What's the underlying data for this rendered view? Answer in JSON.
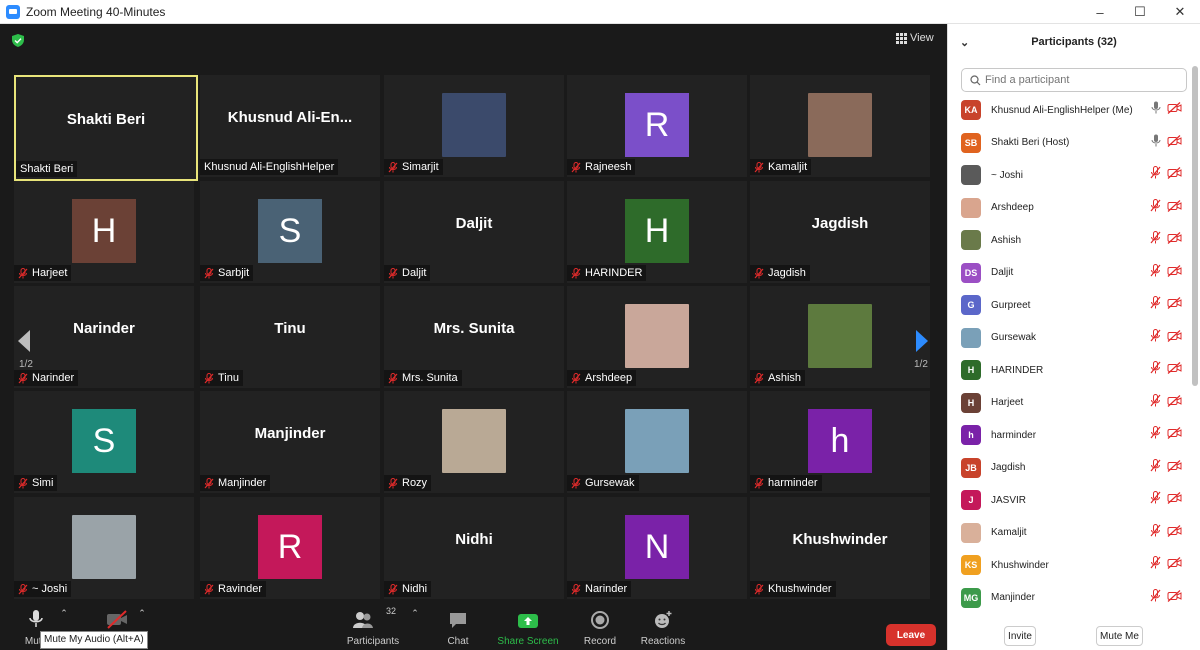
{
  "window": {
    "title": "Zoom Meeting 40-Minutes"
  },
  "view_label": "View",
  "page": {
    "left": "1/2",
    "right": "1/2"
  },
  "tiles": [
    {
      "big": "Shakti Beri",
      "name": "Shakti Beri",
      "muted": false,
      "active": true
    },
    {
      "big": "Khusnud  Ali-En...",
      "name": "Khusnud Ali-EnglishHelper",
      "muted": false
    },
    {
      "photo": "#3b4a6b",
      "name": "Simarjit",
      "muted": true
    },
    {
      "letter": "R",
      "color": "#7b4fc9",
      "name": "Rajneesh",
      "muted": true
    },
    {
      "photo": "#8a6a5a",
      "name": "Kamaljit",
      "muted": true
    },
    {
      "letter": "H",
      "color": "#6b4136",
      "name": "Harjeet",
      "muted": true
    },
    {
      "letter": "S",
      "color": "#4a6275",
      "name": "Sarbjit",
      "muted": true
    },
    {
      "big": "Daljit",
      "name": "Daljit",
      "muted": true
    },
    {
      "letter": "H",
      "color": "#2e6b2a",
      "name": "HARINDER",
      "muted": true
    },
    {
      "big": "Jagdish",
      "name": "Jagdish",
      "muted": true
    },
    {
      "big": "Narinder",
      "name": "Narinder",
      "muted": true
    },
    {
      "big": "Tinu",
      "name": "Tinu",
      "muted": true
    },
    {
      "big": "Mrs.  Sunita",
      "name": "Mrs. Sunita",
      "muted": true
    },
    {
      "photo": "#c9a79a",
      "name": "Arshdeep",
      "muted": true
    },
    {
      "photo": "#5d7a3e",
      "name": "Ashish",
      "muted": true
    },
    {
      "letter": "S",
      "color": "#1e8a7a",
      "name": "Simi",
      "muted": true
    },
    {
      "big": "Manjinder",
      "name": "Manjinder",
      "muted": true
    },
    {
      "photo": "#b9a995",
      "name": "Rozy",
      "muted": true
    },
    {
      "photo": "#7aa0b8",
      "name": "Gursewak",
      "muted": true
    },
    {
      "letter": "h",
      "color": "#7a22a8",
      "name": "harminder",
      "muted": true
    },
    {
      "photo": "#9aa3a8",
      "name": "~ Joshi",
      "muted": true
    },
    {
      "letter": "R",
      "color": "#c4185a",
      "name": "Ravinder",
      "muted": true
    },
    {
      "big": "Nidhi",
      "name": "Nidhi",
      "muted": true
    },
    {
      "letter": "N",
      "color": "#7a22a8",
      "name": "Narinder",
      "muted": true
    },
    {
      "big": "Khushwinder",
      "name": "Khushwinder",
      "muted": true
    }
  ],
  "toolbar": {
    "mute_label": "Mute",
    "tooltip": "Mute My Audio (Alt+A)",
    "participants_label": "Participants",
    "participants_count": "32",
    "chat_label": "Chat",
    "share_label": "Share Screen",
    "record_label": "Record",
    "reactions_label": "Reactions",
    "leave_label": "Leave"
  },
  "panel": {
    "title": "Participants (32)",
    "search_placeholder": "Find a participant",
    "invite_label": "Invite",
    "muteme_label": "Mute Me",
    "participants": [
      {
        "initials": "KA",
        "color": "#c8432b",
        "name": "Khusnud Ali-EnglishHelper (Me)",
        "mic": "on"
      },
      {
        "initials": "SB",
        "color": "#e0631f",
        "name": "Shakti Beri (Host)",
        "mic": "on"
      },
      {
        "initials": "",
        "color": "#5a5a5a",
        "name": "~ Joshi",
        "mic": "off"
      },
      {
        "initials": "",
        "color": "#d9a58e",
        "name": "Arshdeep",
        "mic": "off"
      },
      {
        "initials": "",
        "color": "#6a7a4a",
        "name": "Ashish",
        "mic": "off"
      },
      {
        "initials": "DS",
        "color": "#9b4fc4",
        "name": "Daljit",
        "mic": "off"
      },
      {
        "initials": "G",
        "color": "#5b67c9",
        "name": "Gurpreet",
        "mic": "off"
      },
      {
        "initials": "",
        "color": "#7aa0b8",
        "name": "Gursewak",
        "mic": "off"
      },
      {
        "initials": "H",
        "color": "#2e6b2a",
        "name": "HARINDER",
        "mic": "off"
      },
      {
        "initials": "H",
        "color": "#6b4136",
        "name": "Harjeet",
        "mic": "off"
      },
      {
        "initials": "h",
        "color": "#7a22a8",
        "name": "harminder",
        "mic": "off"
      },
      {
        "initials": "JB",
        "color": "#c8432b",
        "name": "Jagdish",
        "mic": "off"
      },
      {
        "initials": "J",
        "color": "#c4185a",
        "name": "JASVIR",
        "mic": "off"
      },
      {
        "initials": "",
        "color": "#d9b09a",
        "name": "Kamaljit",
        "mic": "off"
      },
      {
        "initials": "KS",
        "color": "#f0a020",
        "name": "Khushwinder",
        "mic": "off"
      },
      {
        "initials": "MG",
        "color": "#3c9a4a",
        "name": "Manjinder",
        "mic": "off"
      }
    ]
  },
  "colors": {
    "muted_red": "#e02b2b",
    "share_green": "#2dbd4a",
    "leave_red": "#d7322c",
    "active_border": "#e8e47a"
  }
}
